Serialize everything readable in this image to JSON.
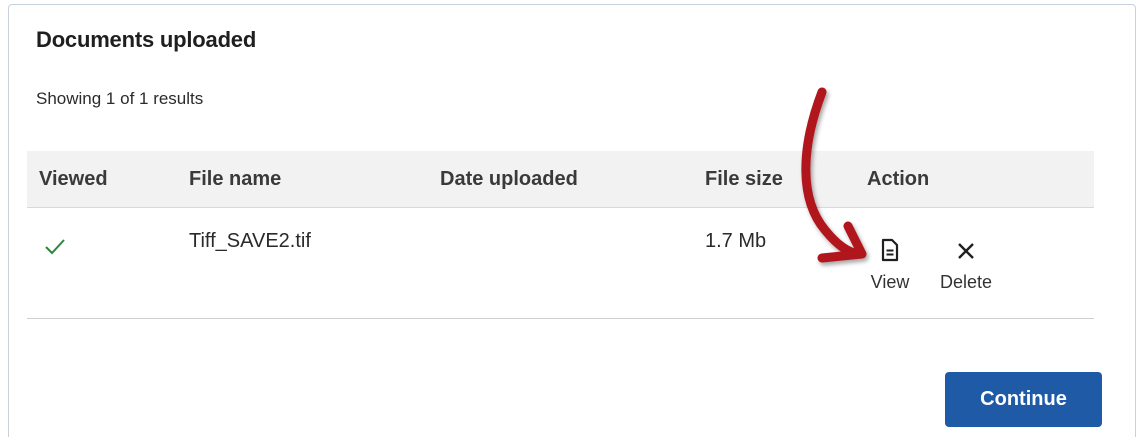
{
  "panel": {
    "title": "Documents uploaded",
    "result_count": "Showing 1 of 1 results"
  },
  "table": {
    "columns": [
      "Viewed",
      "File name",
      "Date uploaded",
      "File size",
      "Action"
    ],
    "rows": [
      {
        "viewed": true,
        "viewed_icon": "checkmark-icon",
        "file_name": "Tiff_SAVE2.tif",
        "date_uploaded": "",
        "file_size": "1.7 Mb",
        "actions": [
          {
            "label": "View",
            "icon": "document-icon"
          },
          {
            "label": "Delete",
            "icon": "close-icon"
          }
        ]
      }
    ]
  },
  "footer": {
    "continue_label": "Continue"
  },
  "colors": {
    "primary_button": "#1f5aa6",
    "check_green": "#2e8540",
    "annotation_arrow": "#b0121b",
    "header_background": "#f2f2f2"
  }
}
